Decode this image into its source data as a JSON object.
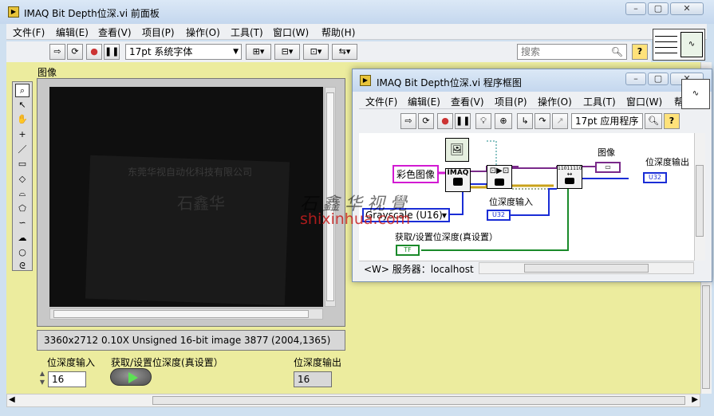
{
  "front_panel": {
    "title": "IMAQ Bit Depth位深.vi 前面板",
    "menus": [
      "文件(F)",
      "编辑(E)",
      "查看(V)",
      "项目(P)",
      "操作(O)",
      "工具(T)",
      "窗口(W)",
      "帮助(H)"
    ],
    "font_select": "17pt 系统字体",
    "search_placeholder": "搜索",
    "image_label": "图像",
    "image_info": "3360x2712 0.10X Unsigned 16-bit image 3877",
    "image_coords": "(2004,1365)",
    "bitdepth_in_label": "位深度输入",
    "bitdepth_in_value": "16",
    "getset_label": "获取/设置位深度(真设置）",
    "bitdepth_out_label": "位深度输出",
    "bitdepth_out_value": "16",
    "photo_texts": [
      "东莞华视自动化科技有限公司",
      "石鑫华"
    ]
  },
  "block_diagram": {
    "title": "IMAQ Bit Depth位深.vi 程序框图",
    "menus": [
      "文件(F)",
      "编辑(E)",
      "查看(V)",
      "项目(P)",
      "操作(O)",
      "工具(T)",
      "窗口(W)",
      "帮"
    ],
    "font_select": "17pt 应用程序",
    "color_image_label": "彩色图像",
    "imaq_label": "IMAQ",
    "bits_label": "11011110",
    "image_label": "图像",
    "bitdepth_out_label": "位深度输出",
    "u32_label": "U32",
    "bitdepth_in_label": "位深度输入",
    "grayscale_value": "Grayscale (U16)",
    "getset_label": "获取/设置位深度(真设置）",
    "tf_label": "TF",
    "status_target": "<W> 服务器：localhost"
  },
  "watermark": {
    "brand": "石鑫华视覺",
    "url": "shixinhua.com"
  },
  "colors": {
    "panel_bg": "#ecec9e",
    "image_bg": "#111111",
    "wire_pink": "#d21ad2",
    "wire_blue": "#1a2dd6",
    "wire_green": "#1a8a2a",
    "wire_purple": "#6a1a7a"
  }
}
